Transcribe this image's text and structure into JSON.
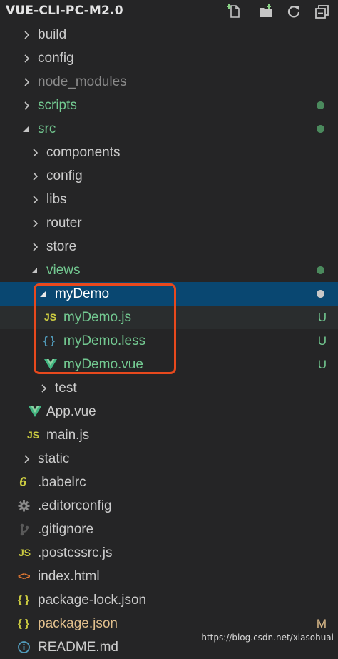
{
  "explorer": {
    "title": "VUE-CLI-PC-M2.0",
    "actions": [
      {
        "name": "new-file-icon"
      },
      {
        "name": "new-folder-icon"
      },
      {
        "name": "refresh-icon"
      },
      {
        "name": "collapse-all-icon"
      }
    ]
  },
  "tree": {
    "build": "build",
    "config": "config",
    "node_modules": "node_modules",
    "scripts": "scripts",
    "src": "src",
    "components": "components",
    "config2": "config",
    "libs": "libs",
    "router": "router",
    "store": "store",
    "views": "views",
    "myDemo": "myDemo",
    "myDemo_js": "myDemo.js",
    "myDemo_less": "myDemo.less",
    "myDemo_vue": "myDemo.vue",
    "test": "test",
    "app_vue": "App.vue",
    "main_js": "main.js",
    "static": "static",
    "babelrc": ".babelrc",
    "editorconfig": ".editorconfig",
    "gitignore": ".gitignore",
    "postcssrc": ".postcssrc.js",
    "index_html": "index.html",
    "package_lock": "package-lock.json",
    "package_json": "package.json",
    "readme": "README.md"
  },
  "status": {
    "untracked": "U",
    "modified": "M"
  },
  "icons": {
    "js": "JS",
    "braces": "{ }",
    "babel": "6",
    "html": "<>"
  },
  "colors": {
    "background": "#252526",
    "selection": "#094771",
    "untracked_green": "#73c991",
    "modified_amber": "#e2c08d",
    "vue_green": "#41b883",
    "js_yellow": "#cbcb41",
    "highlight_box": "#e8491d"
  },
  "watermark": "https://blog.csdn.net/xiasohuai"
}
